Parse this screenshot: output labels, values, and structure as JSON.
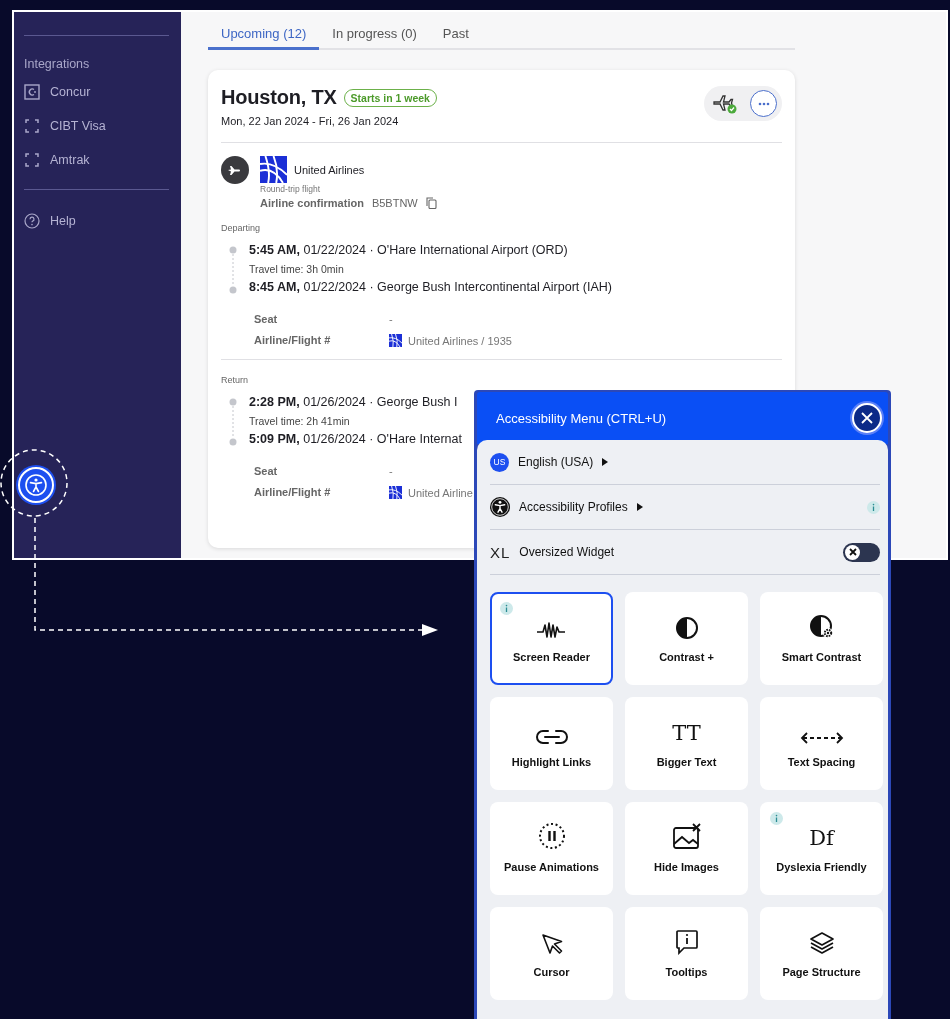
{
  "sidebar": {
    "section_title": "Integrations",
    "items": [
      {
        "label": "Concur",
        "kind": "concur"
      },
      {
        "label": "CIBT Visa",
        "kind": "frame"
      },
      {
        "label": "Amtrak",
        "kind": "frame"
      }
    ],
    "help": "Help"
  },
  "tabs": [
    {
      "label": "Upcoming (12)",
      "selected": true
    },
    {
      "label": "In progress (0)",
      "selected": false
    },
    {
      "label": "Past",
      "selected": false
    }
  ],
  "trip": {
    "title": "Houston, TX",
    "badge": "Starts in 1 week",
    "dates": "Mon, 22 Jan 2024 - Fri, 26 Jan 2024",
    "airline": "United Airlines",
    "flight_type": "Round-trip flight",
    "confirmation_label": "Airline confirmation",
    "confirmation_code": "B5BTNW",
    "legs": [
      {
        "heading": "Departing",
        "departure": "**5:45 AM,** 01/22/2024 · O'Hare International Airport (ORD)",
        "travel_time": "Travel time: 3h 0min",
        "arrival": "**8:45 AM,** 01/22/2024 · George Bush Intercontinental Airport (IAH)",
        "details": [
          {
            "label": "Seat",
            "value": "-",
            "logo": false
          },
          {
            "label": "Airline/Flight #",
            "value": "United Airlines / 1935",
            "logo": true
          }
        ]
      },
      {
        "heading": "Return",
        "departure": "**2:28 PM,** 01/26/2024 · George Bush I",
        "travel_time": "Travel time: 2h 41min",
        "arrival": "**5:09 PM,** 01/26/2024 · O'Hare Internat",
        "details": [
          {
            "label": "Seat",
            "value": "-",
            "logo": false
          },
          {
            "label": "Airline/Flight #",
            "value": "United Airline",
            "logo": true
          }
        ]
      }
    ]
  },
  "accessibility_menu": {
    "title": "Accessibility Menu (CTRL+U)",
    "language": {
      "badge": "US",
      "label": "English (USA)"
    },
    "profiles": {
      "label": "Accessibility Profiles",
      "info": true
    },
    "oversized": {
      "glyph": "XL",
      "label": "Oversized Widget",
      "on": false
    },
    "tiles": [
      {
        "label": "Screen Reader",
        "kind": "reader",
        "selected": true,
        "info": true
      },
      {
        "label": "Contrast +",
        "kind": "contrast",
        "selected": false,
        "info": false
      },
      {
        "label": "Smart Contrast",
        "kind": "smart",
        "selected": false,
        "info": false
      },
      {
        "label": "Highlight Links",
        "kind": "links",
        "selected": false,
        "info": false
      },
      {
        "label": "Bigger Text",
        "kind": "glyph",
        "glyph": "TT",
        "selected": false,
        "info": false
      },
      {
        "label": "Text Spacing",
        "kind": "spacing",
        "selected": false,
        "info": false
      },
      {
        "label": "Pause Animations",
        "kind": "pause",
        "selected": false,
        "info": false
      },
      {
        "label": "Hide Images",
        "kind": "images",
        "selected": false,
        "info": false
      },
      {
        "label": "Dyslexia Friendly",
        "kind": "glyph",
        "glyph": "Df",
        "selected": false,
        "info": true
      },
      {
        "label": "Cursor",
        "kind": "cursor",
        "selected": false,
        "info": false
      },
      {
        "label": "Tooltips",
        "kind": "tooltips",
        "selected": false,
        "info": false
      },
      {
        "label": "Page Structure",
        "kind": "layers",
        "selected": false,
        "info": false
      }
    ]
  }
}
